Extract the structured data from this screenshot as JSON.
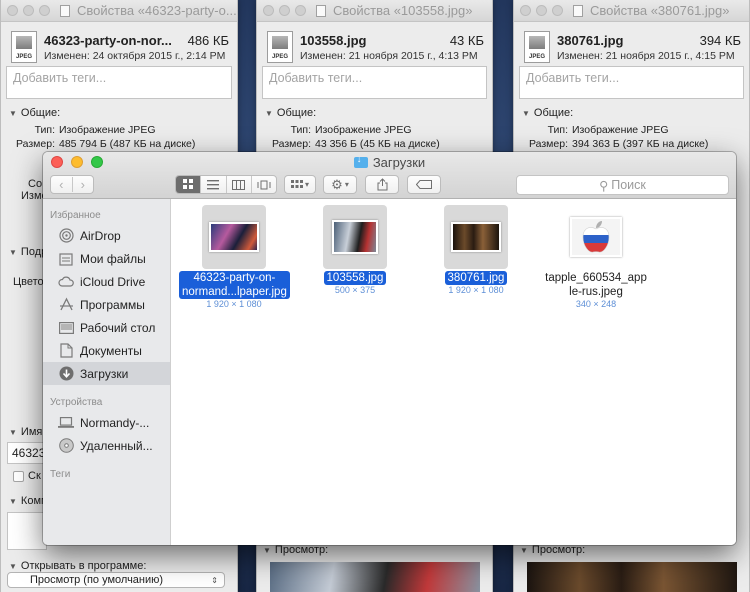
{
  "info_windows": [
    {
      "title": "Свойства «46323-party-o...",
      "name": "46323-party-on-nor...",
      "size": "486 КБ",
      "modified": "Изменен: 24 октября 2015 г., 2:14 PM",
      "tags_placeholder": "Добавить теги...",
      "general_label": "Общие:",
      "type_key": "Тип:",
      "type_val": "Изображение JPEG",
      "size_key": "Размер:",
      "size_val": "485 794 Б (487 КБ на диске)"
    },
    {
      "title": "Свойства «103558.jpg»",
      "name": "103558.jpg",
      "size": "43 КБ",
      "modified": "Изменен: 21 ноября 2015 г., 4:13 PM",
      "tags_placeholder": "Добавить теги...",
      "general_label": "Общие:",
      "type_key": "Тип:",
      "type_val": "Изображение JPEG",
      "size_key": "Размер:",
      "size_val": "43 356 Б (45 КБ на диске)",
      "preview_label": "Просмотр:"
    },
    {
      "title": "Свойства «380761.jpg»",
      "name": "380761.jpg",
      "size": "394 КБ",
      "modified": "Изменен: 21 ноября 2015 г., 4:15 PM",
      "tags_placeholder": "Добавить теги...",
      "general_label": "Общие:",
      "type_key": "Тип:",
      "type_val": "Изображение JPEG",
      "size_key": "Размер:",
      "size_val": "394 363 Б (397 КБ на диске)",
      "preview_label": "Просмотр:"
    }
  ],
  "info_window_1_partial": {
    "co": "Co",
    "izme": "Изме",
    "podr": "Подр",
    "tsveto": "Цвето",
    "imya": "Имя",
    "name_field": "46323",
    "sk": "Ск",
    "komm": "Комм",
    "open_with": "Открывать в программе:",
    "open_with_value": "Просмотр (по умолчанию)"
  },
  "finder": {
    "title": "Загрузки",
    "search_placeholder": "Поиск",
    "sidebar": {
      "favorites_header": "Избранное",
      "favorites": [
        "AirDrop",
        "Мои файлы",
        "iCloud Drive",
        "Программы",
        "Рабочий стол",
        "Документы",
        "Загрузки"
      ],
      "devices_header": "Устройства",
      "devices": [
        "Normandy-...",
        "Удаленный..."
      ],
      "tags_header": "Теги"
    },
    "files": [
      {
        "name_line1": "46323-party-on-",
        "name_line2": "normand...lpaper.jpg",
        "dims": "1 920 × 1 080",
        "selected": true
      },
      {
        "name_line1": "103558.jpg",
        "name_line2": "",
        "dims": "500 × 375",
        "selected": true
      },
      {
        "name_line1": "380761.jpg",
        "name_line2": "",
        "dims": "1 920 × 1 080",
        "selected": true
      },
      {
        "name_line1": "tapple_660534_app",
        "name_line2": "le-rus.jpeg",
        "dims": "340 × 248",
        "selected": false
      }
    ]
  },
  "colors": {
    "selection": "#1a5fd9",
    "close": "#fc5f57",
    "minimize": "#fdbc2e",
    "maximize": "#33c748"
  }
}
